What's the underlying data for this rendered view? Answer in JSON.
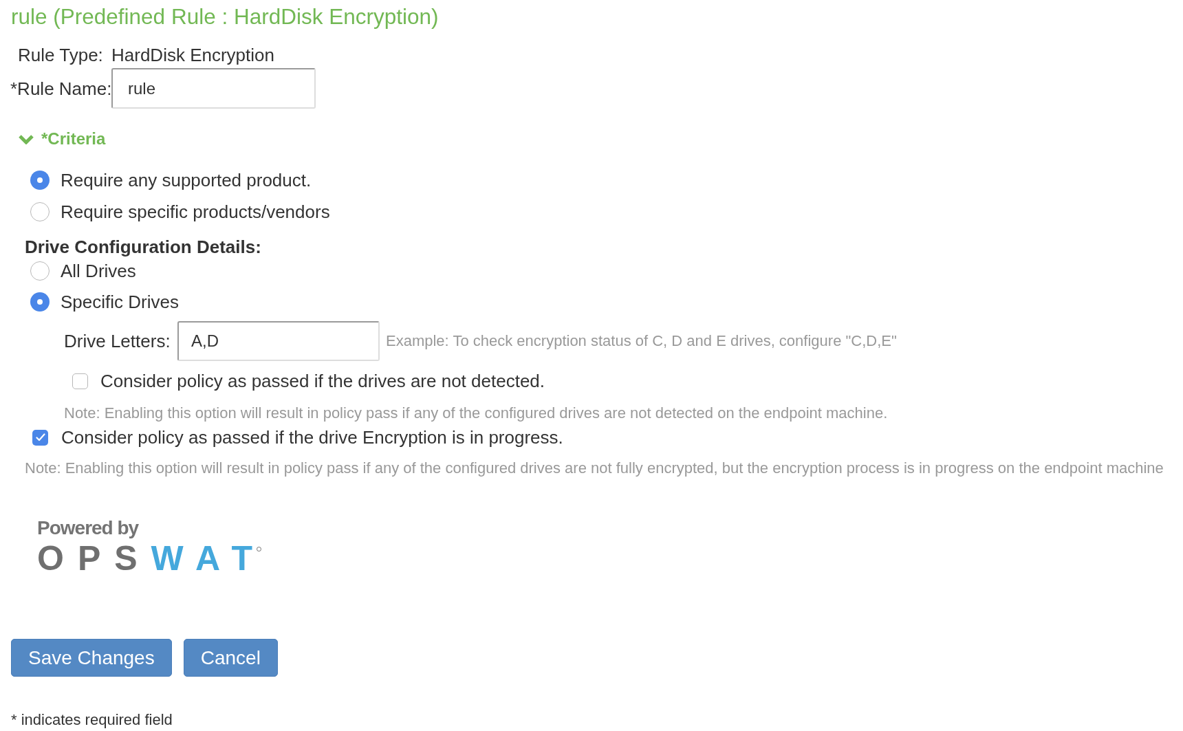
{
  "title": "rule (Predefined Rule : HardDisk Encryption)",
  "rule_type": {
    "label": "Rule Type:",
    "value": "HardDisk Encryption"
  },
  "rule_name": {
    "label": "*Rule Name:",
    "value": "rule"
  },
  "criteria": {
    "label": "*Criteria",
    "expanded": true
  },
  "product_options": [
    {
      "label": "Require any supported product.",
      "selected": true
    },
    {
      "label": "Require specific products/vendors",
      "selected": false
    }
  ],
  "drive_configuration": {
    "heading": "Drive Configuration Details:",
    "options": [
      {
        "label": "All Drives",
        "selected": false
      },
      {
        "label": "Specific Drives",
        "selected": true
      }
    ],
    "drive_letters": {
      "label": "Drive Letters:",
      "value": "A,D",
      "hint": "Example: To check encryption status of C, D and E drives, configure \"C,D,E\""
    },
    "not_detected": {
      "label": "Consider policy as passed if the drives are not detected.",
      "checked": false,
      "note": "Note: Enabling this option will result in policy pass if any of the configured drives are not detected on the endpoint machine."
    }
  },
  "in_progress": {
    "label": "Consider policy as passed if the drive Encryption is in progress.",
    "checked": true,
    "note": "Note: Enabling this option will result in policy pass if any of the configured drives are not fully encrypted, but the encryption process is in progress on the endpoint machine"
  },
  "logo": {
    "caption": "Powered by",
    "wordmark": "OPSWAT"
  },
  "buttons": [
    "Save Changes",
    "Cancel"
  ],
  "footnote": "* indicates required field"
}
